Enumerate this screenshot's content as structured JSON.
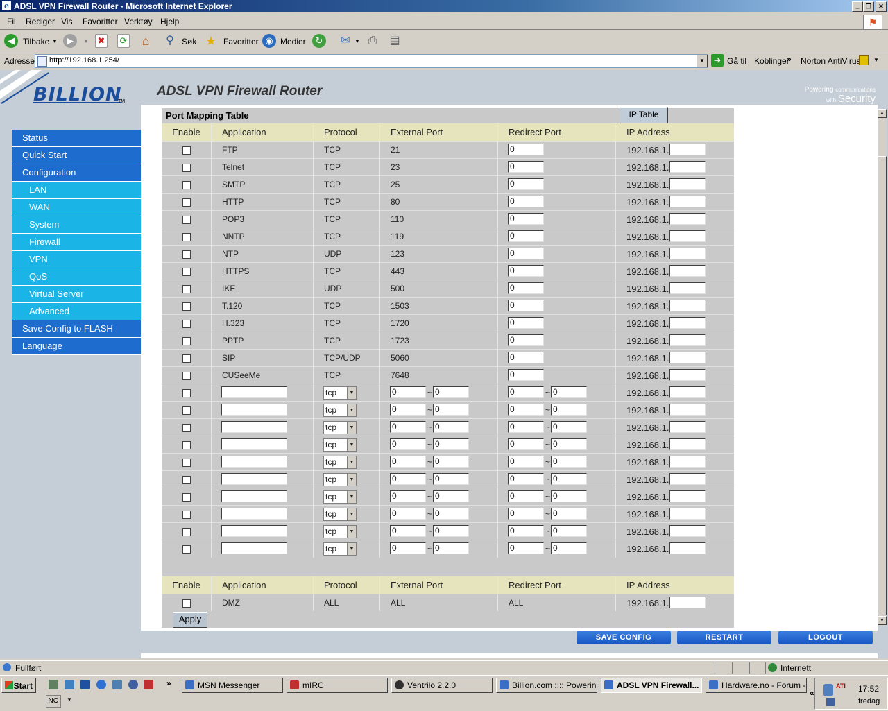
{
  "window": {
    "title": "ADSL VPN Firewall Router - Microsoft Internet Explorer",
    "ie_icon": "e"
  },
  "menu": [
    "Fil",
    "Rediger",
    "Vis",
    "Favoritter",
    "Verktøy",
    "Hjelp"
  ],
  "toolbar": {
    "back": "Tilbake",
    "search": "Søk",
    "favorites": "Favoritter",
    "media": "Medier"
  },
  "address": {
    "label": "Adresse",
    "url": "http://192.168.1.254/",
    "go": "Gå til",
    "links": "Koblinger",
    "links_arrow": "»",
    "norton": "Norton AntiVirus"
  },
  "page": {
    "logo": "BILLION",
    "logo_tm": "TM",
    "title": "ADSL VPN Firewall Router",
    "powering": "Powering",
    "powering_sub": "communications",
    "with": "with",
    "security": "Security"
  },
  "nav": {
    "status": "Status",
    "quick_start": "Quick Start",
    "configuration": "Configuration",
    "lan": "LAN",
    "wan": "WAN",
    "system": "System",
    "firewall": "Firewall",
    "vpn": "VPN",
    "qos": "QoS",
    "virtual_server": "Virtual Server",
    "advanced": "Advanced",
    "save_config_flash": "Save Config to FLASH",
    "language": "Language"
  },
  "table": {
    "title": "Port Mapping Table",
    "ip_table_button": "IP Table",
    "headers": [
      "Enable",
      "Application",
      "Protocol",
      "External Port",
      "Redirect Port",
      "IP Address"
    ],
    "ip_prefix": "192.168.1.",
    "tilde": "~",
    "rows": [
      {
        "app": "FTP",
        "protocol": "TCP",
        "ext": "21",
        "redirect": "0"
      },
      {
        "app": "Telnet",
        "protocol": "TCP",
        "ext": "23",
        "redirect": "0"
      },
      {
        "app": "SMTP",
        "protocol": "TCP",
        "ext": "25",
        "redirect": "0"
      },
      {
        "app": "HTTP",
        "protocol": "TCP",
        "ext": "80",
        "redirect": "0"
      },
      {
        "app": "POP3",
        "protocol": "TCP",
        "ext": "110",
        "redirect": "0"
      },
      {
        "app": "NNTP",
        "protocol": "TCP",
        "ext": "119",
        "redirect": "0"
      },
      {
        "app": "NTP",
        "protocol": "UDP",
        "ext": "123",
        "redirect": "0"
      },
      {
        "app": "HTTPS",
        "protocol": "TCP",
        "ext": "443",
        "redirect": "0"
      },
      {
        "app": "IKE",
        "protocol": "UDP",
        "ext": "500",
        "redirect": "0"
      },
      {
        "app": "T.120",
        "protocol": "TCP",
        "ext": "1503",
        "redirect": "0"
      },
      {
        "app": "H.323",
        "protocol": "TCP",
        "ext": "1720",
        "redirect": "0"
      },
      {
        "app": "PPTP",
        "protocol": "TCP",
        "ext": "1723",
        "redirect": "0"
      },
      {
        "app": "SIP",
        "protocol": "TCP/UDP",
        "ext": "5060",
        "redirect": "0"
      },
      {
        "app": "CUSeeMe",
        "protocol": "TCP",
        "ext": "7648",
        "redirect": "0"
      }
    ],
    "custom_rows": [
      {
        "protocol": "tcp",
        "ext_from": "0",
        "ext_to": "0",
        "red_from": "0",
        "red_to": "0"
      },
      {
        "protocol": "tcp",
        "ext_from": "0",
        "ext_to": "0",
        "red_from": "0",
        "red_to": "0"
      },
      {
        "protocol": "tcp",
        "ext_from": "0",
        "ext_to": "0",
        "red_from": "0",
        "red_to": "0"
      },
      {
        "protocol": "tcp",
        "ext_from": "0",
        "ext_to": "0",
        "red_from": "0",
        "red_to": "0"
      },
      {
        "protocol": "tcp",
        "ext_from": "0",
        "ext_to": "0",
        "red_from": "0",
        "red_to": "0"
      },
      {
        "protocol": "tcp",
        "ext_from": "0",
        "ext_to": "0",
        "red_from": "0",
        "red_to": "0"
      },
      {
        "protocol": "tcp",
        "ext_from": "0",
        "ext_to": "0",
        "red_from": "0",
        "red_to": "0"
      },
      {
        "protocol": "tcp",
        "ext_from": "0",
        "ext_to": "0",
        "red_from": "0",
        "red_to": "0"
      },
      {
        "protocol": "tcp",
        "ext_from": "0",
        "ext_to": "0",
        "red_from": "0",
        "red_to": "0"
      },
      {
        "protocol": "tcp",
        "ext_from": "0",
        "ext_to": "0",
        "red_from": "0",
        "red_to": "0"
      }
    ],
    "dmz": {
      "app": "DMZ",
      "protocol": "ALL",
      "ext": "ALL",
      "redirect": "ALL"
    },
    "apply": "Apply"
  },
  "actions": {
    "save_config": "SAVE CONFIG",
    "restart": "RESTART",
    "logout": "LOGOUT"
  },
  "statusbar": {
    "text": "Fullført",
    "zone": "Internett"
  },
  "taskbar": {
    "start": "Start",
    "tasks": [
      "MSN Messenger",
      "mIRC",
      "Ventrilo 2.2.0",
      "Billion.com :::: Powerin...",
      "ADSL VPN Firewall...",
      "Hardware.no - Forum -..."
    ],
    "lang": "NO",
    "clock": "17:52",
    "day": "fredag",
    "ati": "ATI"
  }
}
